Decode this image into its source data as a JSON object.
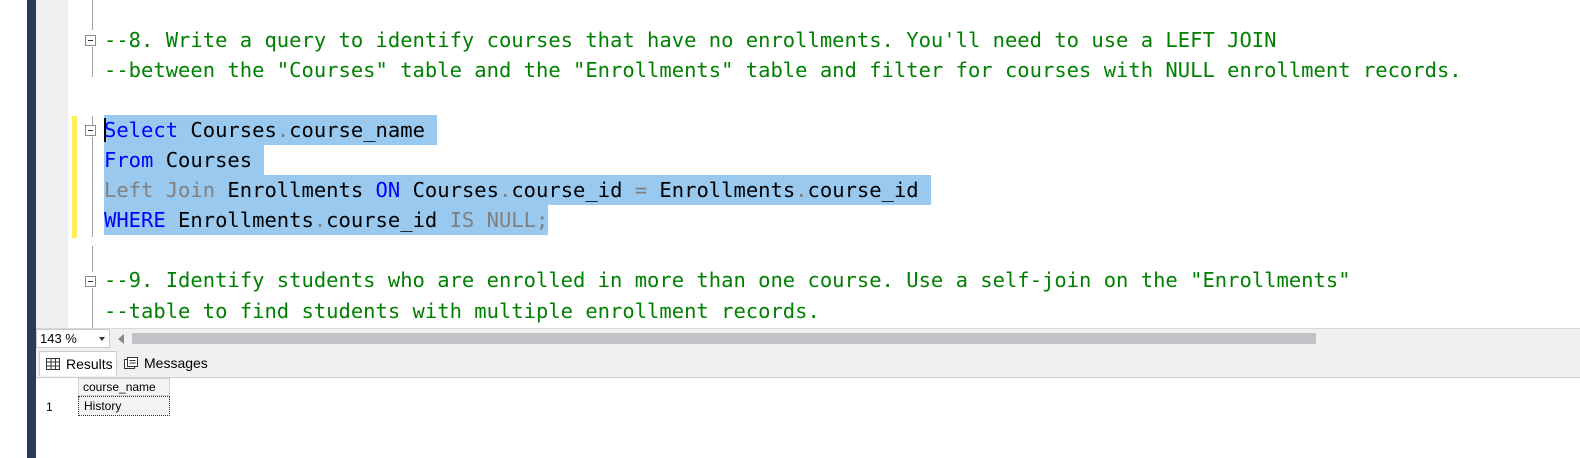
{
  "editor": {
    "lines": [
      {
        "segments": [
          {
            "text": "--8. Write a query to identify courses that have no enrollments. You'll need to use a LEFT JOIN",
            "cls": "comment"
          }
        ]
      },
      {
        "segments": [
          {
            "text": "--between the \"Courses\" table and the \"Enrollments\" table and filter for courses with NULL enrollment records.",
            "cls": "comment"
          }
        ]
      },
      {
        "segments": [
          {
            "text": "Select",
            "cls": "kw"
          },
          {
            "text": " Courses",
            "cls": "id"
          },
          {
            "text": ".",
            "cls": "gray"
          },
          {
            "text": "course_name ",
            "cls": "id"
          }
        ]
      },
      {
        "segments": [
          {
            "text": "From",
            "cls": "kw"
          },
          {
            "text": " Courses ",
            "cls": "id"
          }
        ]
      },
      {
        "segments": [
          {
            "text": "Left Join",
            "cls": "gray"
          },
          {
            "text": " Enrollments ",
            "cls": "id"
          },
          {
            "text": "ON",
            "cls": "kw"
          },
          {
            "text": " Courses",
            "cls": "id"
          },
          {
            "text": ".",
            "cls": "gray"
          },
          {
            "text": "course_id ",
            "cls": "id"
          },
          {
            "text": "=",
            "cls": "gray"
          },
          {
            "text": " Enrollments",
            "cls": "id"
          },
          {
            "text": ".",
            "cls": "gray"
          },
          {
            "text": "course_id ",
            "cls": "id"
          }
        ]
      },
      {
        "segments": [
          {
            "text": "WHERE",
            "cls": "kw"
          },
          {
            "text": " Enrollments",
            "cls": "id"
          },
          {
            "text": ".",
            "cls": "gray"
          },
          {
            "text": "course_id ",
            "cls": "id"
          },
          {
            "text": "IS NULL;",
            "cls": "gray"
          }
        ]
      },
      {
        "segments": [
          {
            "text": "--9. Identify students who are enrolled in more than one course. Use a self-join on the \"Enrollments\"",
            "cls": "comment"
          }
        ]
      },
      {
        "segments": [
          {
            "text": "--table to find students with multiple enrollment records.",
            "cls": "comment"
          }
        ]
      }
    ]
  },
  "statusbar": {
    "zoom": "143 %"
  },
  "tabs": {
    "results": "Results",
    "messages": "Messages"
  },
  "results": {
    "columns": [
      "course_name"
    ],
    "rows": [
      {
        "num": "1",
        "course_name": "History"
      }
    ]
  }
}
